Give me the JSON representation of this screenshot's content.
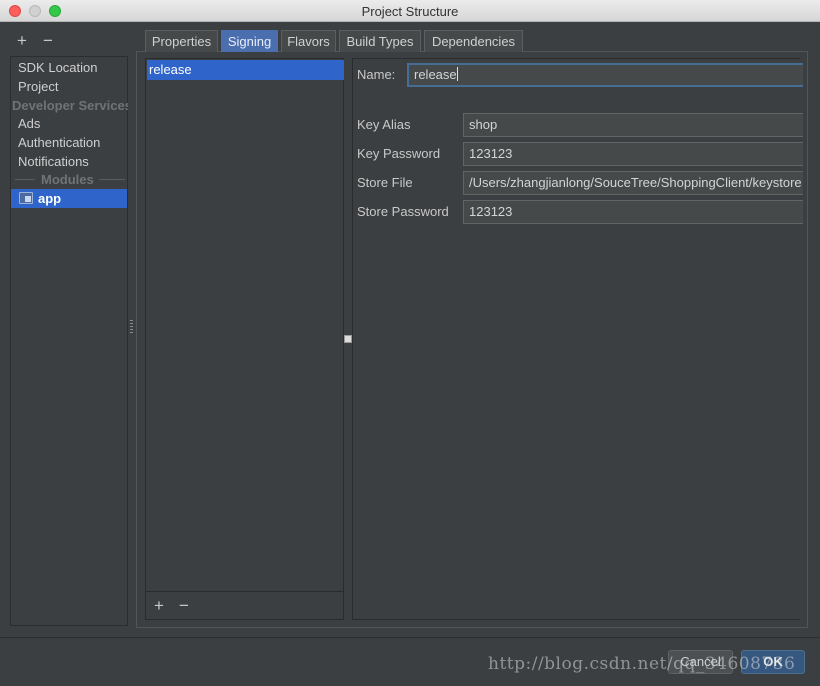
{
  "window": {
    "title": "Project Structure"
  },
  "left_toolbar": {
    "add": "+",
    "remove": "−"
  },
  "sidebar": {
    "items": [
      "SDK Location",
      "Project"
    ],
    "section_developer": "Developer Services",
    "developer_items": [
      "Ads",
      "Authentication",
      "Notifications"
    ],
    "section_modules": "Modules",
    "module": "app"
  },
  "tabs": [
    {
      "label": "Properties",
      "active": false
    },
    {
      "label": "Signing",
      "active": true
    },
    {
      "label": "Flavors",
      "active": false
    },
    {
      "label": "Build Types",
      "active": false
    },
    {
      "label": "Dependencies",
      "active": false
    }
  ],
  "signing_list": {
    "selected": "release",
    "footer_add": "+",
    "footer_remove": "−"
  },
  "form": {
    "name_label": "Name:",
    "name_value": "release",
    "fields": [
      {
        "label": "Key Alias",
        "value": "shop"
      },
      {
        "label": "Key Password",
        "value": "123123"
      },
      {
        "label": "Store File",
        "value": "/Users/zhangjianlong/SouceTree/ShoppingClient/keystore"
      },
      {
        "label": "Store Password",
        "value": "123123"
      }
    ]
  },
  "buttons": {
    "cancel": "Cancel",
    "ok": "OK"
  },
  "watermark": "http://blog.csdn.net/qq_34608736",
  "colors": {
    "background": "#3c3f41",
    "selection": "#2f65ca",
    "active_tab": "#4b6eaf",
    "ok_button": "#365880"
  }
}
